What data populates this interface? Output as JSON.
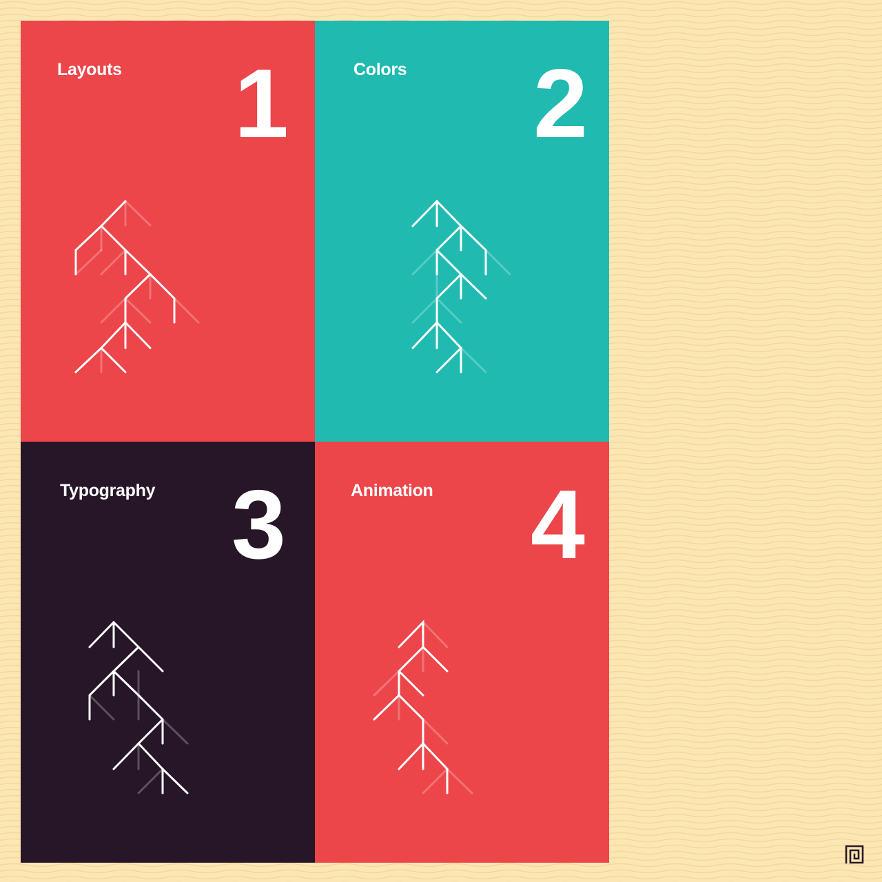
{
  "colors": {
    "background": "#fce7b4",
    "red": "#ec454a",
    "teal": "#20bab1",
    "dark": "#261628",
    "line": "#ffffff",
    "logo": "#2a1a2a"
  },
  "cards": [
    {
      "label": "Layouts",
      "number": "1",
      "color": "red",
      "icon": "tree-branch-icon"
    },
    {
      "label": "Colors",
      "number": "2",
      "color": "teal",
      "icon": "tree-branch-icon"
    },
    {
      "label": "Typography",
      "number": "3",
      "color": "dark",
      "icon": "tree-branch-icon"
    },
    {
      "label": "Animation",
      "number": "4",
      "color": "red",
      "icon": "tree-branch-icon"
    }
  ],
  "logo": {
    "icon": "spiral-logo-icon"
  }
}
